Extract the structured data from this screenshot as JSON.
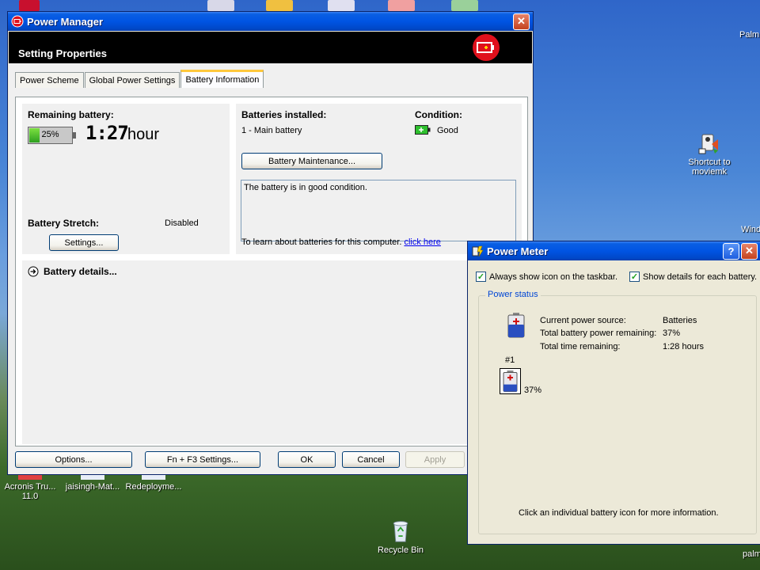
{
  "desktop": {
    "icons": [
      {
        "label": "Acronis Tru...\n11.0"
      },
      {
        "label": "jaisingh-Mat..."
      },
      {
        "label": "Redeployme..."
      },
      {
        "label": "Recycle Bin"
      },
      {
        "label": "Shortcut to\nmoviemk"
      },
      {
        "label": "Palm"
      },
      {
        "label": "Wind"
      },
      {
        "label": "palm"
      }
    ]
  },
  "power_manager": {
    "title": "Power Manager",
    "header_title": "Setting Properties",
    "tabs": [
      {
        "label": "Power Scheme"
      },
      {
        "label": "Global Power Settings"
      },
      {
        "label": "Battery Information"
      }
    ],
    "remaining": {
      "label": "Remaining battery:",
      "percent_text": "25%",
      "percent_value": 25,
      "time": "1:27",
      "unit": "hour"
    },
    "stretch": {
      "label": "Battery Stretch:",
      "value": "Disabled",
      "settings_button": "Settings..."
    },
    "installed": {
      "label": "Batteries installed:",
      "value": "1 - Main battery",
      "condition_label": "Condition:",
      "condition_value": "Good",
      "maintenance_button": "Battery Maintenance...",
      "status_text": "The battery is in good condition.",
      "learn_text": "To learn about batteries for this computer.",
      "learn_link": "click here"
    },
    "details_label": "Battery details...",
    "footer": {
      "options": "Options...",
      "fn_f3": "Fn + F3 Settings...",
      "ok": "OK",
      "cancel": "Cancel",
      "apply": "Apply"
    }
  },
  "power_meter": {
    "title": "Power Meter",
    "always_show": "Always show icon on the taskbar.",
    "show_details": "Show details for each battery.",
    "group_label": "Power status",
    "rows": [
      {
        "label": "Current power source:",
        "value": "Batteries"
      },
      {
        "label": "Total battery power remaining:",
        "value": "37%"
      },
      {
        "label": "Total time remaining:",
        "value": "1:28 hours"
      }
    ],
    "battery_number": "#1",
    "battery_percent": "37%",
    "battery_level": 37,
    "hint": "Click an individual battery icon for more information."
  }
}
